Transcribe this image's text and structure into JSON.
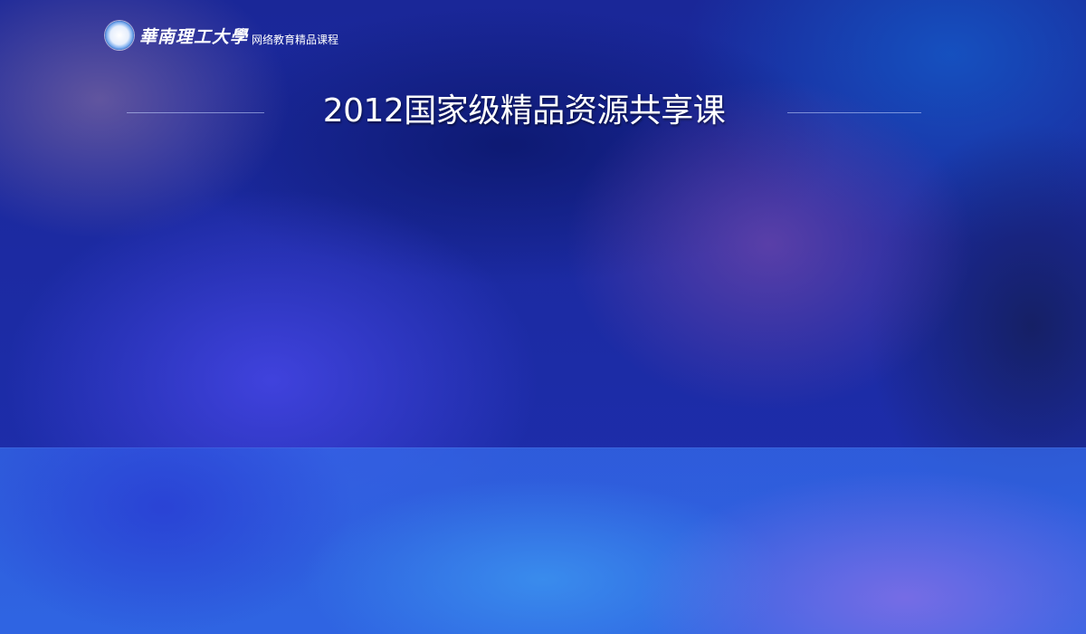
{
  "header": {
    "emblem_icon": "university-seal-icon",
    "university_name": "華南理工大學",
    "subtitle": "网络教育精品课程"
  },
  "main": {
    "title": "2012国家级精品资源共享课"
  },
  "colors": {
    "background": "#1b2a9c",
    "text": "#ffffff"
  }
}
